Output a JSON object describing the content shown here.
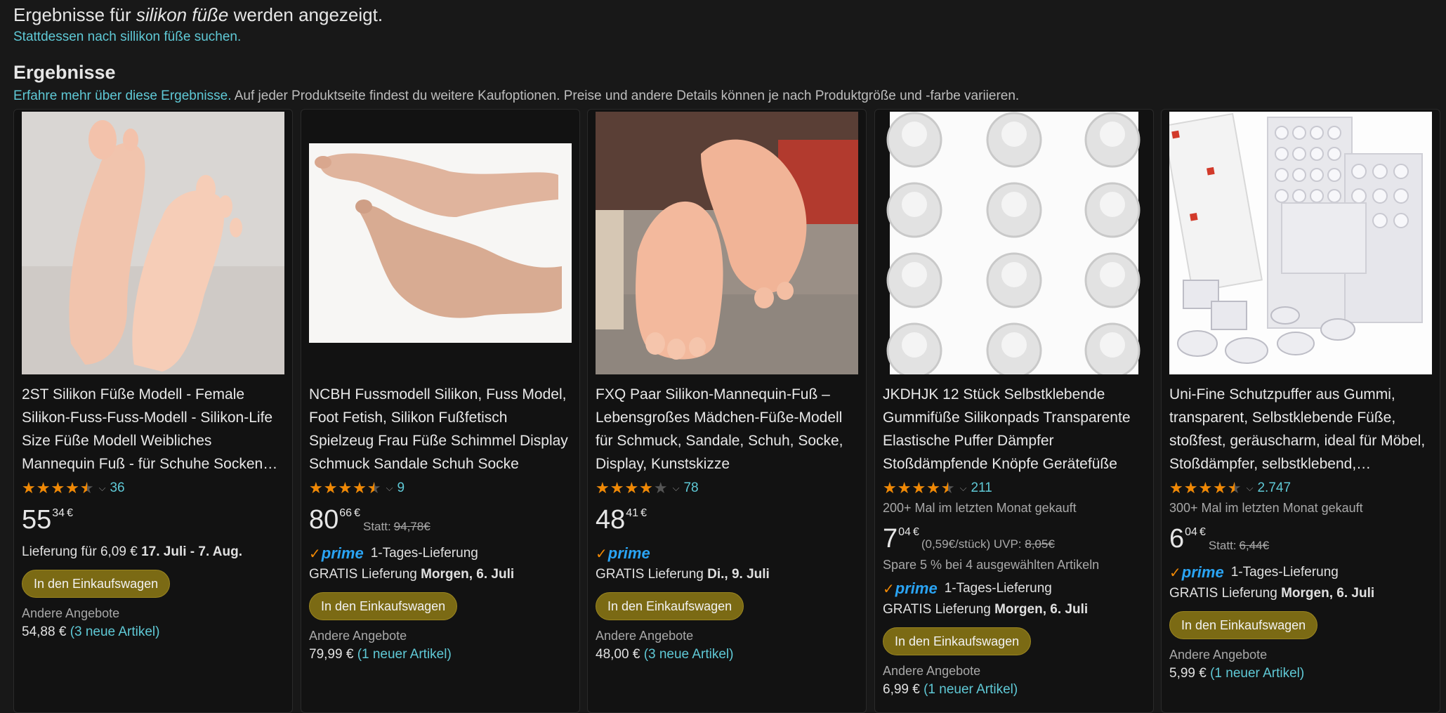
{
  "header": {
    "results_prefix": "Ergebnisse für ",
    "query": "silikon füße",
    "results_suffix": " werden angezeigt.",
    "instead_link": "Stattdessen nach sillikon füße suchen.",
    "section_title": "Ergebnisse",
    "learn_more": "Erfahre mehr über diese Ergebnisse.",
    "section_note": " Auf jeder Produktseite findest du weitere Kaufoptionen. Preise und andere Details können je nach Produktgröße und -farbe variieren."
  },
  "common": {
    "add_to_cart": "In den Einkaufswagen",
    "other_offers": "Andere Angebote",
    "statt": "Statt:",
    "prime": "prime",
    "prime_check": "✓"
  },
  "products": [
    {
      "title": "2ST Silikon Füße Modell - Female Silikon-Fuss-Fuss-Modell - Silikon-Life Size Füße Modell Weibliches Mannequin Fuß - für Schuhe Socken Sandalen",
      "rating": 4.5,
      "reviews": "36",
      "price_whole": "55",
      "price_frac": "34",
      "currency": "€",
      "delivery_prefix": "Lieferung für 6,09 € ",
      "delivery_date": "17. Juli - 7. Aug.",
      "other_price": "54,88 €",
      "other_link": "(3 neue Artikel)"
    },
    {
      "title": "NCBH Fussmodell Silikon, Fuss Model, Foot Fetish, Silikon Fußfetisch Spielzeug Frau Füße Schimmel Display Schmuck Sandale Schuh Socke",
      "rating": 4.5,
      "reviews": "9",
      "price_whole": "80",
      "price_frac": "66",
      "currency": "€",
      "old_price": "94,78€",
      "prime_text": "1-Tages-Lieferung",
      "delivery_prefix": "GRATIS Lieferung ",
      "delivery_date": "Morgen, 6. Juli",
      "other_price": "79,99 €",
      "other_link": "(1 neuer Artikel)"
    },
    {
      "title": "FXQ Paar Silikon-Mannequin-Fuß – Lebensgroßes Mädchen-Füße-Modell für Schmuck, Sandale, Schuh, Socke, Display, Kunstskizze",
      "rating": 4.0,
      "reviews": "78",
      "price_whole": "48",
      "price_frac": "41",
      "currency": "€",
      "prime_text": "",
      "delivery_prefix": "GRATIS Lieferung ",
      "delivery_date": "Di., 9. Juli",
      "other_price": "48,00 €",
      "other_link": "(3 neue Artikel)"
    },
    {
      "title": "JKDHJK 12 Stück Selbstklebende Gummifüße Silikonpads Transparente Elastische Puffer Dämpfer Stoßdämpfende Knöpfe Gerätefüße",
      "rating": 4.5,
      "reviews": "211",
      "bought": "200+ Mal im letzten Monat gekauft",
      "price_whole": "7",
      "price_frac": "04",
      "currency": "€",
      "unit_price": "(0,59€/stück) UVP: ",
      "old_price": "8,05€",
      "spare": "Spare 5 % bei 4 ausgewählten Artikeln",
      "prime_text": "1-Tages-Lieferung",
      "delivery_prefix": "GRATIS Lieferung ",
      "delivery_date": "Morgen, 6. Juli",
      "other_price": "6,99 €",
      "other_link": "(1 neuer Artikel)"
    },
    {
      "title": "Uni-Fine Schutzpuffer aus Gummi, transparent, Selbstklebende Füße, stoßfest, geräuscharm, ideal für Möbel, Stoßdämpfer, selbstklebend, Möbelpuffer",
      "rating": 4.5,
      "reviews": "2.747",
      "bought": "300+ Mal im letzten Monat gekauft",
      "price_whole": "6",
      "price_frac": "04",
      "currency": "€",
      "old_price": "6,44€",
      "prime_text": "1-Tages-Lieferung",
      "delivery_prefix": "GRATIS Lieferung ",
      "delivery_date": "Morgen, 6. Juli",
      "other_price": "5,99 €",
      "other_link": "(1 neuer Artikel)"
    }
  ]
}
